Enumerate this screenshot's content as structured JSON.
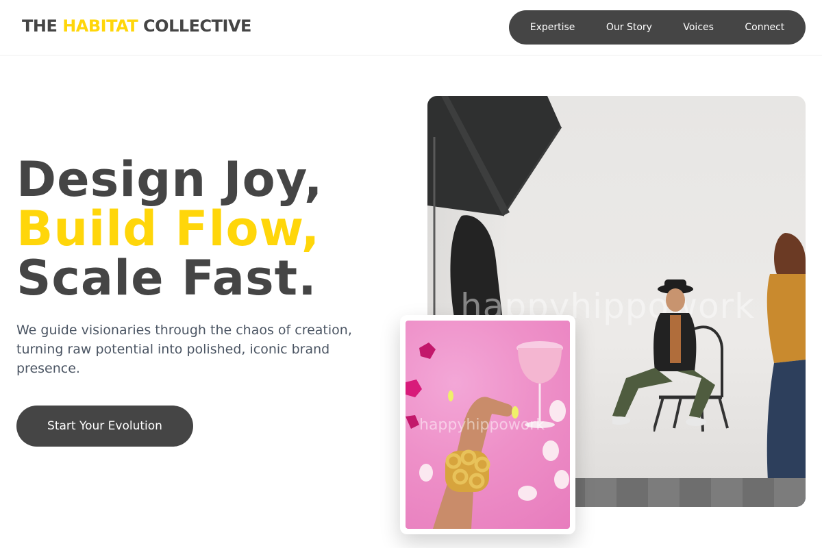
{
  "brand": {
    "prefix": "THE ",
    "highlight": "HABITAT",
    "suffix": " COLLECTIVE"
  },
  "nav": {
    "items": [
      {
        "label": "Expertise"
      },
      {
        "label": "Our Story"
      },
      {
        "label": "Voices"
      },
      {
        "label": "Connect"
      }
    ]
  },
  "hero": {
    "line1": "Design Joy,",
    "line2": "Build Flow,",
    "line3": "Scale Fast.",
    "subcopy": "We guide visionaries through the chaos of creation, turning raw potential into polished, iconic brand presence.",
    "cta_label": "Start Your Evolution"
  },
  "images": {
    "main_watermark": "happyhippowork",
    "card_watermark": "happyhippowork"
  },
  "colors": {
    "accent": "#ffd60a",
    "primary": "#454545",
    "text_secondary": "#4b5563"
  }
}
